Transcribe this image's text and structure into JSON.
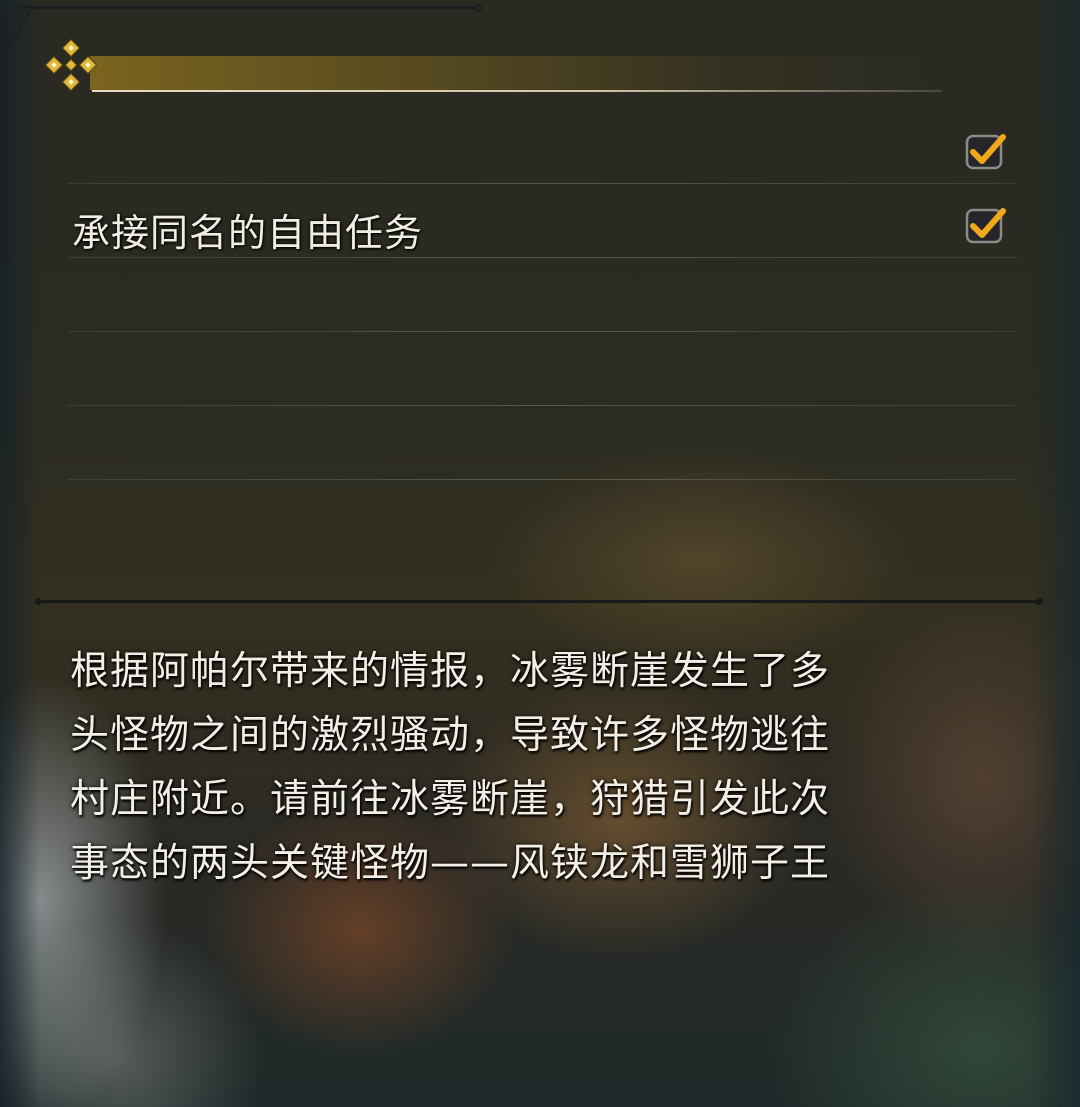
{
  "panel": {
    "header_icon": "ornamental-diamond-icon",
    "accent_color": "#c9a227",
    "check_color": "#f0a81c"
  },
  "options": [
    {
      "label": "",
      "checked": true,
      "icon": "checkmark-icon"
    },
    {
      "label": "承接同名的自由任务",
      "checked": true,
      "icon": "checkmark-icon"
    },
    {
      "label": ""
    },
    {
      "label": ""
    },
    {
      "label": ""
    }
  ],
  "description": {
    "lines": [
      "根据阿帕尔带来的情报，冰雾断崖发生了多",
      "头怪物之间的激烈骚动，导致许多怪物逃往",
      "村庄附近。请前往冰雾断崖，狩猎引发此次",
      "事态的两头关键怪物——风铗龙和雪狮子王"
    ]
  }
}
